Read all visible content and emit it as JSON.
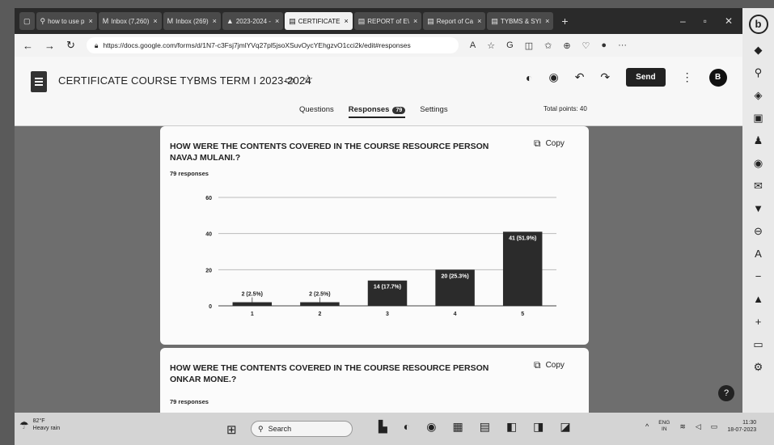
{
  "browser": {
    "tabs": [
      {
        "icon": "search-icon",
        "label": "how to use p"
      },
      {
        "icon": "gmail-icon",
        "label": "Inbox (7,260)"
      },
      {
        "icon": "gmail-icon",
        "label": "Inbox (269)"
      },
      {
        "icon": "drive-icon",
        "label": "2023-2024 -"
      },
      {
        "icon": "forms-icon",
        "label": "CERTIFICATE",
        "active": true
      },
      {
        "icon": "forms-icon",
        "label": "REPORT of E\\"
      },
      {
        "icon": "forms-icon",
        "label": "Report of Ca"
      },
      {
        "icon": "forms-icon",
        "label": "TYBMS & SYI"
      }
    ],
    "url": "https://docs.google.com/forms/d/1N7-c3Fsj7jmlYVq27pl5jsoXSuvOycYEhgzvO1cci2k/edit#responses"
  },
  "form": {
    "title": "CERTIFICATE COURSE TYBMS TERM I 2023-2024",
    "send_label": "Send",
    "avatar_letter": "B",
    "tabs": {
      "questions": "Questions",
      "responses": "Responses",
      "settings": "Settings",
      "responses_badge": "79"
    },
    "total_points": "Total points: 40"
  },
  "questions": [
    {
      "title": "HOW WERE THE CONTENTS COVERED IN THE COURSE RESOURCE PERSON NAVAJ MULANI.?",
      "responses": "79 responses",
      "copy_label": "Copy"
    },
    {
      "title": "HOW WERE THE CONTENTS COVERED IN THE COURSE RESOURCE PERSON ONKAR MONE.?",
      "responses": "79 responses",
      "copy_label": "Copy"
    }
  ],
  "chart_data": {
    "type": "bar",
    "categories": [
      "1",
      "2",
      "3",
      "4",
      "5"
    ],
    "values": [
      2,
      2,
      14,
      20,
      41
    ],
    "labels": [
      "2 (2.5%)",
      "2 (2.5%)",
      "14 (17.7%)",
      "20 (25.3%)",
      "41 (51.9%)"
    ],
    "ylim": [
      0,
      60
    ],
    "yticks": [
      "0",
      "20",
      "40",
      "60"
    ],
    "bar_color": "#2b2b2b",
    "grid": true
  },
  "taskbar": {
    "weather_temp": "82°F",
    "weather_desc": "Heavy rain",
    "search_label": "Search",
    "lang_top": "ENG",
    "lang_bottom": "IN",
    "time": "11:30",
    "date": "18-07-2023"
  }
}
